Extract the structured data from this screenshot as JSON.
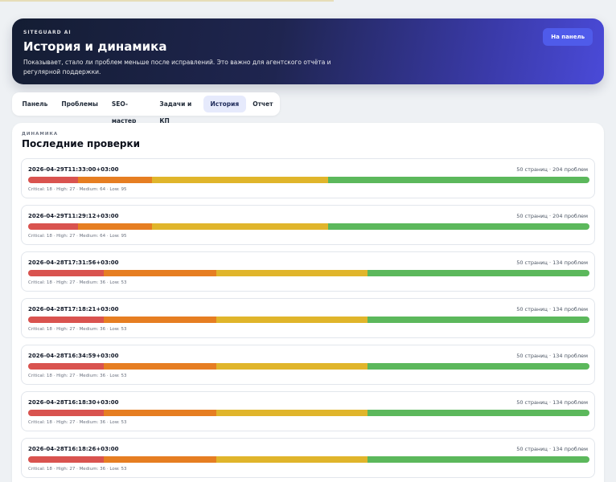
{
  "hero": {
    "brand": "SITEGUARD AI",
    "title": "История и динамика",
    "subtitle": "Показывает, стало ли проблем меньше после исправлений. Это важно для агентского отчёта и регулярной поддержки.",
    "panel_button": "На панель"
  },
  "tabs": [
    {
      "label": "Панель",
      "active": false
    },
    {
      "label": "Проблемы",
      "active": false
    },
    {
      "label": "SEO-мастер",
      "active": false
    },
    {
      "label": "Задачи и КП",
      "active": false
    },
    {
      "label": "История",
      "active": true
    },
    {
      "label": "Отчет",
      "active": false
    }
  ],
  "history": {
    "kicker": "ДИНАМИКА",
    "title": "Последние проверки",
    "colors": {
      "critical": "#d9534f",
      "high": "#e67e22",
      "medium": "#e0b52b",
      "low": "#5cb85c"
    },
    "runs": [
      {
        "date": "2026-04-29T11:33:00+03:00",
        "summary": "50 страниц · 204 проблем",
        "counts": "Critical: 18 · High: 27 · Medium: 64 · Low: 95",
        "critical": 18,
        "high": 27,
        "medium": 64,
        "low": 95
      },
      {
        "date": "2026-04-29T11:29:12+03:00",
        "summary": "50 страниц · 204 проблем",
        "counts": "Critical: 18 · High: 27 · Medium: 64 · Low: 95",
        "critical": 18,
        "high": 27,
        "medium": 64,
        "low": 95
      },
      {
        "date": "2026-04-28T17:31:56+03:00",
        "summary": "50 страниц · 134 проблем",
        "counts": "Critical: 18 · High: 27 · Medium: 36 · Low: 53",
        "critical": 18,
        "high": 27,
        "medium": 36,
        "low": 53
      },
      {
        "date": "2026-04-28T17:18:21+03:00",
        "summary": "50 страниц · 134 проблем",
        "counts": "Critical: 18 · High: 27 · Medium: 36 · Low: 53",
        "critical": 18,
        "high": 27,
        "medium": 36,
        "low": 53
      },
      {
        "date": "2026-04-28T16:34:59+03:00",
        "summary": "50 страниц · 134 проблем",
        "counts": "Critical: 18 · High: 27 · Medium: 36 · Low: 53",
        "critical": 18,
        "high": 27,
        "medium": 36,
        "low": 53
      },
      {
        "date": "2026-04-28T16:18:30+03:00",
        "summary": "50 страниц · 134 проблем",
        "counts": "Critical: 18 · High: 27 · Medium: 36 · Low: 53",
        "critical": 18,
        "high": 27,
        "medium": 36,
        "low": 53
      },
      {
        "date": "2026-04-28T16:18:26+03:00",
        "summary": "50 страниц · 134 проблем",
        "counts": "Critical: 18 · High: 27 · Medium: 36 · Low: 53",
        "critical": 18,
        "high": 27,
        "medium": 36,
        "low": 53
      }
    ]
  }
}
